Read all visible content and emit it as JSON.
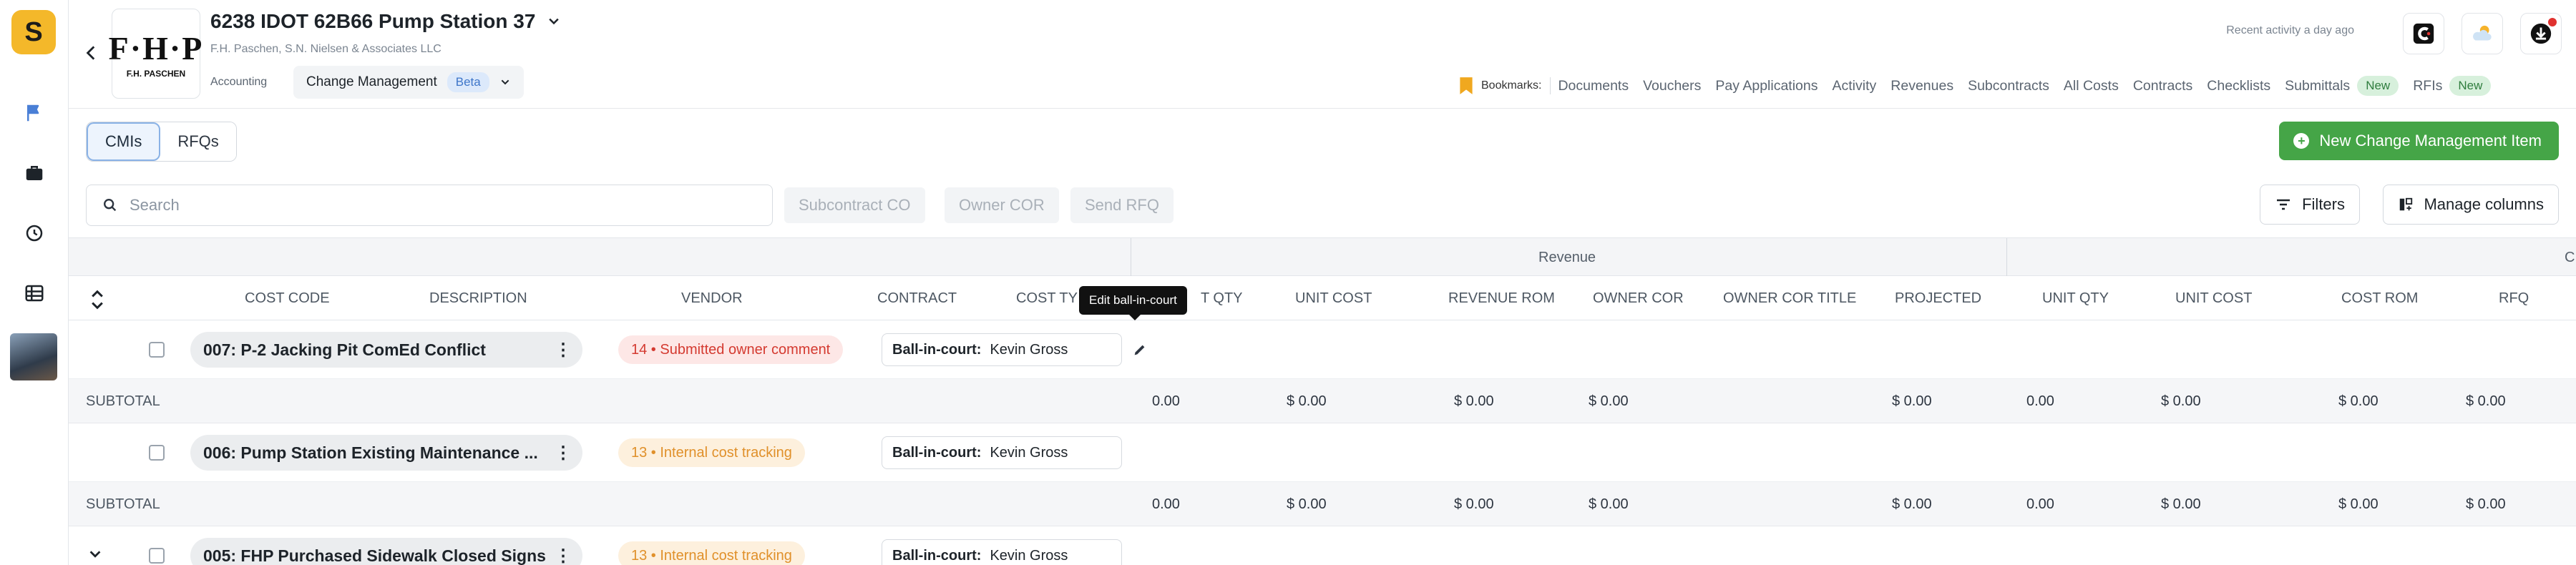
{
  "app": {
    "logo_letter": "S"
  },
  "project": {
    "title": "6238 IDOT 62B66 Pump Station 37",
    "subtitle": "F.H. Paschen, S.N. Nielsen & Associates LLC",
    "accounting": "Accounting",
    "module": "Change Management",
    "module_badge": "Beta",
    "company_logo_big": "F·H·P",
    "company_logo_small": "F.H. PASCHEN"
  },
  "header": {
    "recent_activity": "Recent activity a day ago"
  },
  "bookmarks": {
    "label": "Bookmarks:",
    "links": [
      "Documents",
      "Vouchers",
      "Pay Applications",
      "Activity",
      "Revenues",
      "Subcontracts",
      "All Costs",
      "Contracts",
      "Checklists",
      "Submittals",
      "RFIs"
    ],
    "new_badge": "New"
  },
  "tabs": [
    "CMIs",
    "RFQs"
  ],
  "actions": {
    "new_item": "New Change Management Item",
    "search_placeholder": "Search",
    "subcontract_co": "Subcontract CO",
    "owner_cor": "Owner COR",
    "send_rfq": "Send RFQ",
    "filters": "Filters",
    "manage_columns": "Manage columns"
  },
  "table": {
    "group_revenue": "Revenue",
    "group_cost_partial": "C",
    "columns": [
      "COST CODE",
      "DESCRIPTION",
      "VENDOR",
      "CONTRACT",
      "COST TYPE",
      "UNIT QTY",
      "UNIT COST",
      "REVENUE ROM",
      "OWNER COR",
      "OWNER COR TITLE",
      "PROJECTED",
      "UNIT QTY",
      "UNIT COST",
      "COST ROM",
      "RFQ"
    ],
    "header_partial": {
      "cost_type": "COST TY",
      "unit_qty": "T QTY"
    },
    "rows": [
      {
        "name": "007: P-2 Jacking Pit ComEd Conflict",
        "status": "14 • Submitted owner comment",
        "status_color": "red",
        "bic_label": "Ball-in-court:",
        "bic_value": "Kevin Gross"
      },
      {
        "name": "006: Pump Station Existing Maintenance ...",
        "status": "13 • Internal cost tracking",
        "status_color": "orange",
        "bic_label": "Ball-in-court:",
        "bic_value": "Kevin Gross"
      },
      {
        "name": "005: FHP Purchased Sidewalk Closed Signs",
        "status": "13 • Internal cost tracking",
        "status_color": "orange",
        "bic_label": "Ball-in-court:",
        "bic_value": "Kevin Gross"
      }
    ],
    "subtotal_label": "SUBTOTAL",
    "subtotal_values": [
      "0.00",
      "$ 0.00",
      "$ 0.00",
      "$ 0.00",
      "$ 0.00",
      "0.00",
      "$ 0.00",
      "$ 0.00",
      "$ 0.00"
    ]
  },
  "tooltip": "Edit ball-in-court",
  "colors": {
    "accent_green": "#45a547",
    "logo_yellow": "#f4b82a",
    "status_red": "#d43a30",
    "status_orange": "#e0902a"
  }
}
